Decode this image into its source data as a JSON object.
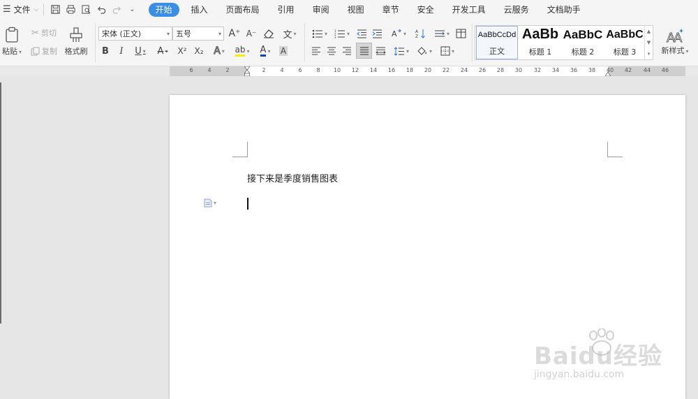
{
  "menubar": {
    "file_label": "文件",
    "tabs": [
      "开始",
      "插入",
      "页面布局",
      "引用",
      "审阅",
      "视图",
      "章节",
      "安全",
      "开发工具",
      "云服务",
      "文档助手"
    ],
    "active_tab": "开始",
    "accent_color": "#3a8ee6"
  },
  "ribbon": {
    "paste_label": "粘贴",
    "cut_label": "剪切",
    "copy_label": "复制",
    "format_painter_label": "格式刷",
    "font_name": "宋体 (正文)",
    "font_size": "五号",
    "bold_glyph": "B",
    "italic_glyph": "I",
    "underline_glyph": "U",
    "strike_glyph": "A",
    "superscript_glyph": "X²",
    "subscript_glyph": "X₂",
    "text_effect_glyph": "A",
    "highlight_glyph": "ab",
    "font_color_glyph": "A",
    "char_shade_glyph": "A",
    "grow_font_glyph": "A⁺",
    "shrink_font_glyph": "A⁻",
    "phonetic_glyph": "文",
    "new_style_label": "新样式",
    "styles": [
      {
        "sample": "AaBbCcDd",
        "name": "正文"
      },
      {
        "sample": "AaBb",
        "name": "标题 1"
      },
      {
        "sample": "AaBbC",
        "name": "标题 2"
      },
      {
        "sample": "AaBbC",
        "name": "标题 3"
      }
    ]
  },
  "ruler": {
    "ticks": [
      "6",
      "4",
      "2",
      "2",
      "4",
      "6",
      "8",
      "10",
      "12",
      "14",
      "16",
      "18",
      "20",
      "22",
      "24",
      "26",
      "28",
      "30",
      "32",
      "34",
      "36",
      "38",
      "40",
      "42",
      "44",
      "46"
    ]
  },
  "document": {
    "text": "接下来是季度销售图表"
  },
  "watermark": {
    "brand": "Baidu经验",
    "url": "jingyan.baidu.com"
  }
}
